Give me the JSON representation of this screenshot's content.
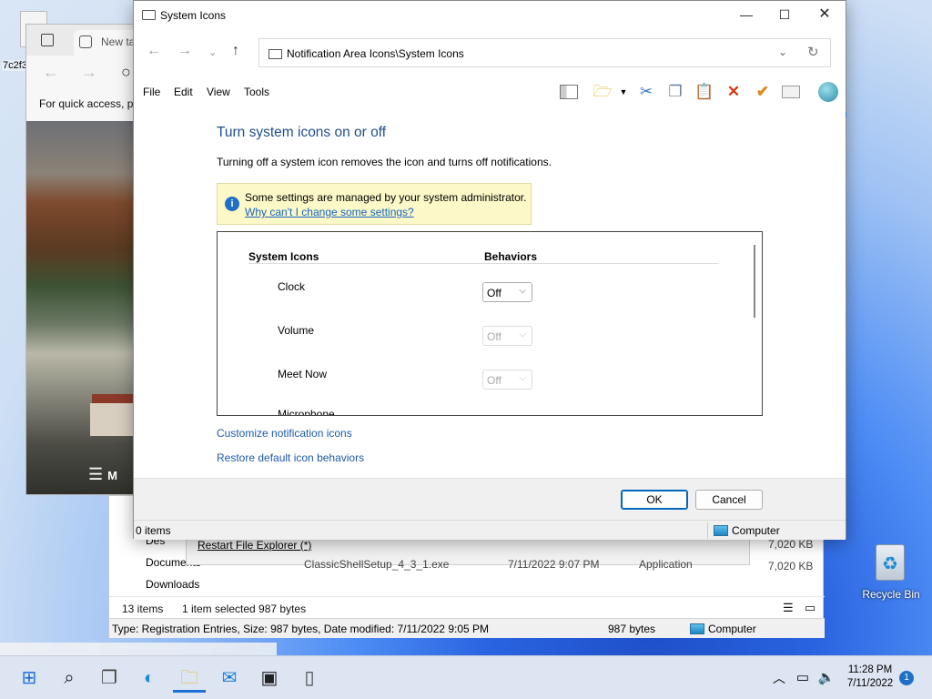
{
  "desktop": {
    "top_icon_label": "7c2f3",
    "recycle_bin_label": "Recycle Bin"
  },
  "edge": {
    "tab_title": "New ta",
    "quick_access_text": "For quick access, pl",
    "menu_text": "M"
  },
  "explorer": {
    "sidebar": [
      "Des",
      "Documents",
      "Downloads"
    ],
    "context_item": "Restart File Explorer (*)",
    "row": {
      "name": "ClassicShellSetup_4_3_1.exe",
      "date": "7/11/2022 9:07 PM",
      "type": "Application",
      "size": "7,020 KB"
    },
    "size_above": "7,020 KB",
    "status_items": "13 items",
    "status_selected": "1 item selected  987 bytes",
    "bottom_info": "Type: Registration Entries, Size: 987 bytes, Date modified: 7/11/2022 9:05 PM",
    "bottom_size": "987 bytes",
    "bottom_location": "Computer"
  },
  "dialog": {
    "title": "System Icons",
    "address": "Notification Area Icons\\System Icons",
    "menu": [
      "File",
      "Edit",
      "View",
      "Tools"
    ],
    "heading": "Turn system icons on or off",
    "description": "Turning off a system icon removes the icon and turns off notifications.",
    "info_text": "Some settings are managed by your system administrator.",
    "info_link": "Why can't I change some settings?",
    "col_icons": "System Icons",
    "col_behaviors": "Behaviors",
    "rows": [
      {
        "name": "Clock",
        "value": "Off",
        "enabled": true
      },
      {
        "name": "Volume",
        "value": "Off",
        "enabled": false
      },
      {
        "name": "Meet Now",
        "value": "Off",
        "enabled": false
      },
      {
        "name": "Microphone",
        "value": "",
        "enabled": false
      }
    ],
    "link_customize": "Customize notification icons",
    "link_restore": "Restore default icon behaviors",
    "ok_label": "OK",
    "cancel_label": "Cancel",
    "status_left": "0 items",
    "status_right": "Computer",
    "help_glyph": "?",
    "info_glyph": "i"
  },
  "toolbar_icons": [
    "preview-pane-icon",
    "folder-check-icon",
    "cut-icon",
    "copy-icon",
    "paste-icon",
    "delete-icon",
    "check-icon",
    "properties-icon",
    "shell-icon"
  ],
  "taskbar": {
    "time": "11:28 PM",
    "date": "7/11/2022",
    "notification_count": "1"
  },
  "colors": {
    "accent": "#0067c0",
    "heading": "#1e4e8c",
    "link": "#1e5aa6",
    "info_bg": "#fcf8c8"
  }
}
